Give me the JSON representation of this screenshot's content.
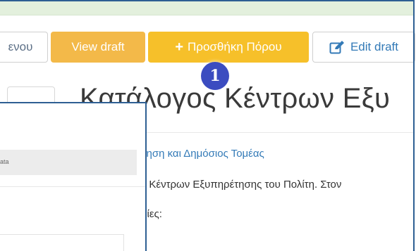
{
  "toolbar": {
    "back_label": "ενου",
    "view_draft_label": "View draft",
    "add_resource_label": "Προσθήκη Πόρου",
    "edit_draft_label": "Edit draft"
  },
  "marker": {
    "label": "1"
  },
  "page": {
    "title": "Κατάλογος Κέντρων Εξυ",
    "category_link": "νηση και Δημόσιος Τομέας",
    "body_line1": "ς Κέντρων Εξυπηρέτησης του Πολίτη. Στον",
    "body_line2": "ρίες:"
  },
  "overlay": {
    "field_text": "ata"
  },
  "colors": {
    "frame_border": "#2e5f93",
    "green_strip": "#e3f0dd",
    "view_draft": "#f3b949",
    "add_resource": "#f6c02a",
    "link": "#337ab7",
    "marker": "#3b4cc0"
  }
}
